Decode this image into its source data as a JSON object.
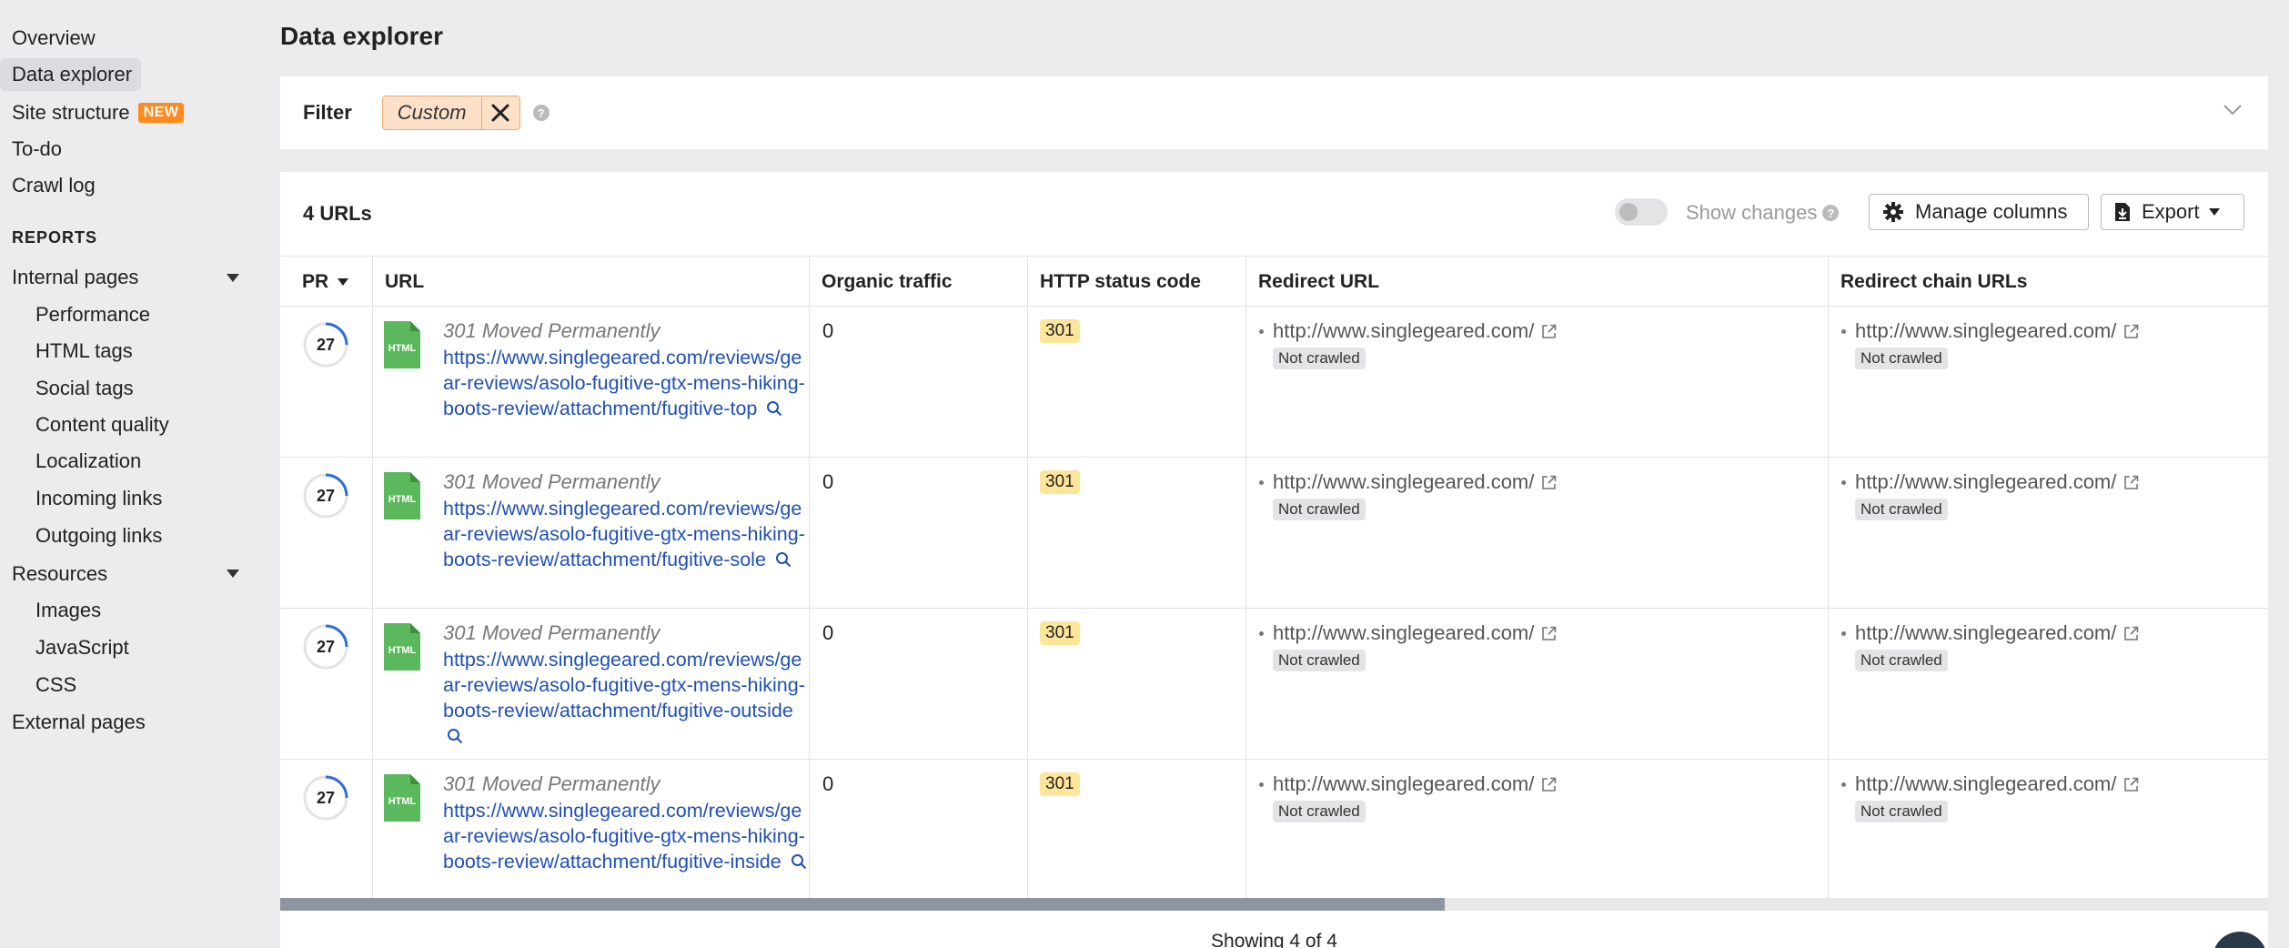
{
  "sidebar": {
    "items": [
      {
        "label": "Overview"
      },
      {
        "label": "Data explorer"
      },
      {
        "label": "Site structure",
        "badge": "NEW"
      },
      {
        "label": "To-do"
      },
      {
        "label": "Crawl log"
      }
    ],
    "reports_heading": "REPORTS",
    "internal_pages": {
      "label": "Internal pages",
      "children": [
        "Performance",
        "HTML tags",
        "Social tags",
        "Content quality",
        "Localization",
        "Incoming links",
        "Outgoing links"
      ]
    },
    "resources": {
      "label": "Resources",
      "children": [
        "Images",
        "JavaScript",
        "CSS"
      ]
    },
    "external_pages": "External pages"
  },
  "main": {
    "title": "Data explorer",
    "filter": {
      "label": "Filter",
      "chip": "Custom",
      "help": "?"
    },
    "url_count": "4 URLs",
    "show_changes": "Show changes",
    "manage_columns": "Manage columns",
    "export": "Export",
    "columns": [
      "PR",
      "URL",
      "Organic traffic",
      "HTTP status code",
      "Redirect URL",
      "Redirect chain URLs"
    ],
    "icon_label": "HTML",
    "rows": [
      {
        "pr": "27",
        "status": "301 Moved Permanently",
        "url": "https://www.singlegeared.com/reviews/gear-reviews/asolo-fugitive-gtx-mens-hiking-boots-review/attachment/fugitive-top",
        "traffic": "0",
        "code": "301",
        "redirect": "http://www.singlegeared.com/",
        "redirect_tag": "Not crawled",
        "chain": "http://www.singlegeared.com/",
        "chain_tag": "Not crawled"
      },
      {
        "pr": "27",
        "status": "301 Moved Permanently",
        "url": "https://www.singlegeared.com/reviews/gear-reviews/asolo-fugitive-gtx-mens-hiking-boots-review/attachment/fugitive-sole",
        "traffic": "0",
        "code": "301",
        "redirect": "http://www.singlegeared.com/",
        "redirect_tag": "Not crawled",
        "chain": "http://www.singlegeared.com/",
        "chain_tag": "Not crawled"
      },
      {
        "pr": "27",
        "status": "301 Moved Permanently",
        "url": "https://www.singlegeared.com/reviews/gear-reviews/asolo-fugitive-gtx-mens-hiking-boots-review/attachment/fugitive-outside",
        "traffic": "0",
        "code": "301",
        "redirect": "http://www.singlegeared.com/",
        "redirect_tag": "Not crawled",
        "chain": "http://www.singlegeared.com/",
        "chain_tag": "Not crawled"
      },
      {
        "pr": "27",
        "status": "301 Moved Permanently",
        "url": "https://www.singlegeared.com/reviews/gear-reviews/asolo-fugitive-gtx-mens-hiking-boots-review/attachment/fugitive-inside",
        "traffic": "0",
        "code": "301",
        "redirect": "http://www.singlegeared.com/",
        "redirect_tag": "Not crawled",
        "chain": "http://www.singlegeared.com/",
        "chain_tag": "Not crawled"
      }
    ],
    "showing": "Showing 4 of 4"
  },
  "colors": {
    "accent_orange": "#ff8a1d",
    "link": "#1f4fb8",
    "code_badge": "#fde59a",
    "pr_ring": "#2f6fd6"
  }
}
